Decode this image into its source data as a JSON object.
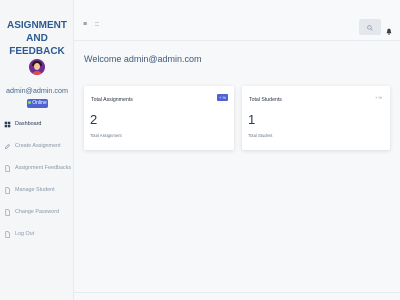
{
  "brand": {
    "line1": "ASIGNMENT AND",
    "line2": "FEEDBACK"
  },
  "user": {
    "email": "admin@admin.com",
    "status": "Online"
  },
  "nav": {
    "items": [
      {
        "label": "Dashboard",
        "icon": "dashboard-icon",
        "active": true
      },
      {
        "label": "Create Assignment",
        "icon": "edit-icon",
        "active": false
      },
      {
        "label": "Assignment Feedbacks",
        "icon": "file-icon",
        "active": false
      },
      {
        "label": "Manage Student",
        "icon": "file-icon",
        "active": false
      },
      {
        "label": "Change Password",
        "icon": "file-icon",
        "active": false
      },
      {
        "label": "Log Out",
        "icon": "file-icon",
        "active": false
      }
    ]
  },
  "topbar": {
    "menu_icon": "≡",
    "grid_icon": "::"
  },
  "main": {
    "welcome": "Welcome admin@admin.com",
    "cards": [
      {
        "title": "Total Assignments",
        "value": "2",
        "subtitle": "Total Assignment",
        "badge": "+ %"
      },
      {
        "title": "Total Students",
        "value": "1",
        "subtitle": "Total Student",
        "badge": "+ %"
      }
    ]
  },
  "colors": {
    "brand": "#2e5a92",
    "badge": "#4f63d2"
  }
}
